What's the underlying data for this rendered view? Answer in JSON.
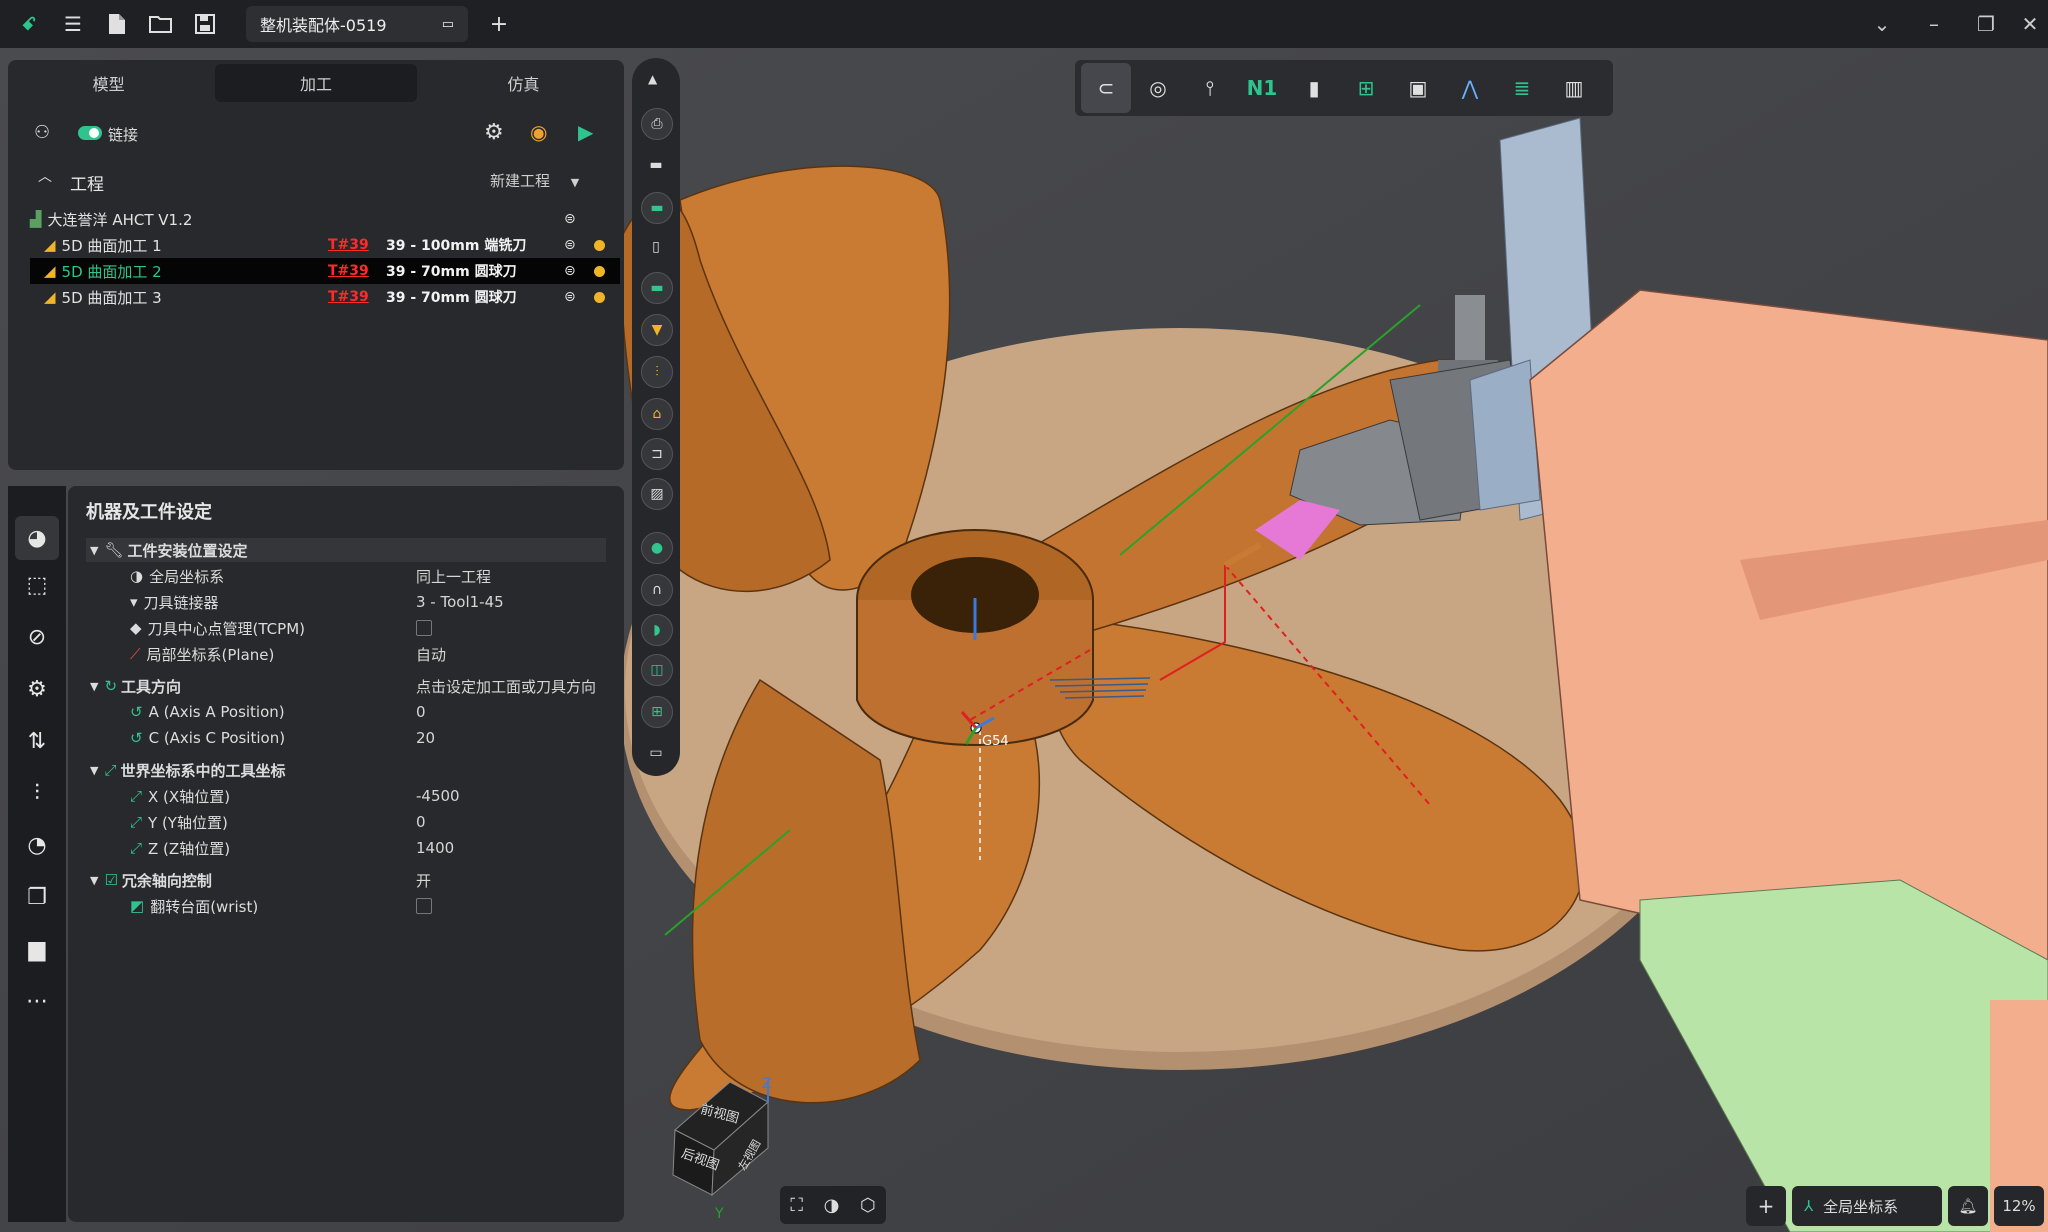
{
  "titlebar": {
    "document_tab": "整机装配体-0519",
    "add_tab": "+"
  },
  "left_panel": {
    "tabs": [
      "模型",
      "加工",
      "仿真"
    ],
    "active_tab": 1,
    "link_label": "链接",
    "section_title": "工程",
    "new_project": "新建工程",
    "project_name": "大连誉洋 AHCT V1.2",
    "operations": [
      {
        "name": "5D 曲面加工 1",
        "tool_no": "T#39",
        "tool": "39 - 100mm 端铣刀"
      },
      {
        "name": "5D 曲面加工 2",
        "tool_no": "T#39",
        "tool": "39 - 70mm 圆球刀"
      },
      {
        "name": "5D 曲面加工 3",
        "tool_no": "T#39",
        "tool": "39 - 70mm 圆球刀"
      }
    ]
  },
  "settings_panel": {
    "title": "机器及工件设定",
    "groups": {
      "install": {
        "label": "工件安装位置设定",
        "rows": [
          {
            "label": "全局坐标系",
            "value": "同上一工程"
          },
          {
            "label": "刀具链接器",
            "value": "3 - Tool1-45"
          },
          {
            "label": "刀具中心点管理(TCPM)",
            "value": ""
          },
          {
            "label": "局部坐标系(Plane)",
            "value": "自动"
          }
        ]
      },
      "tool_dir": {
        "label": "工具方向",
        "value": "点击设定加工面或刀具方向",
        "rows": [
          {
            "label": "A (Axis A Position)",
            "value": "0"
          },
          {
            "label": "C (Axis C Position)",
            "value": "20"
          }
        ]
      },
      "world": {
        "label": "世界坐标系中的工具坐标",
        "rows": [
          {
            "label": "X (X轴位置)",
            "value": "-4500"
          },
          {
            "label": "Y (Y轴位置)",
            "value": "0"
          },
          {
            "label": "Z (Z轴位置)",
            "value": "1400"
          }
        ]
      },
      "redundant": {
        "label": "冗余轴向控制",
        "value": "开",
        "rows": [
          {
            "label": "翻转台面(wrist)",
            "value": ""
          }
        ]
      }
    }
  },
  "viewport": {
    "origin_label": "G54",
    "axis_z": "Z",
    "axis_y": "Y",
    "cube_top": "前视图",
    "cube_left": "后视图",
    "cube_right": "左视图",
    "toolbar_n1": "N1"
  },
  "statusbar": {
    "add": "+",
    "coord_system": "全局坐标系",
    "zoom": "12%"
  },
  "colors": {
    "propeller": "#c97a33",
    "table": "#b08d6c",
    "machine": "#f3ae8e",
    "accent": "#2fc48d"
  }
}
